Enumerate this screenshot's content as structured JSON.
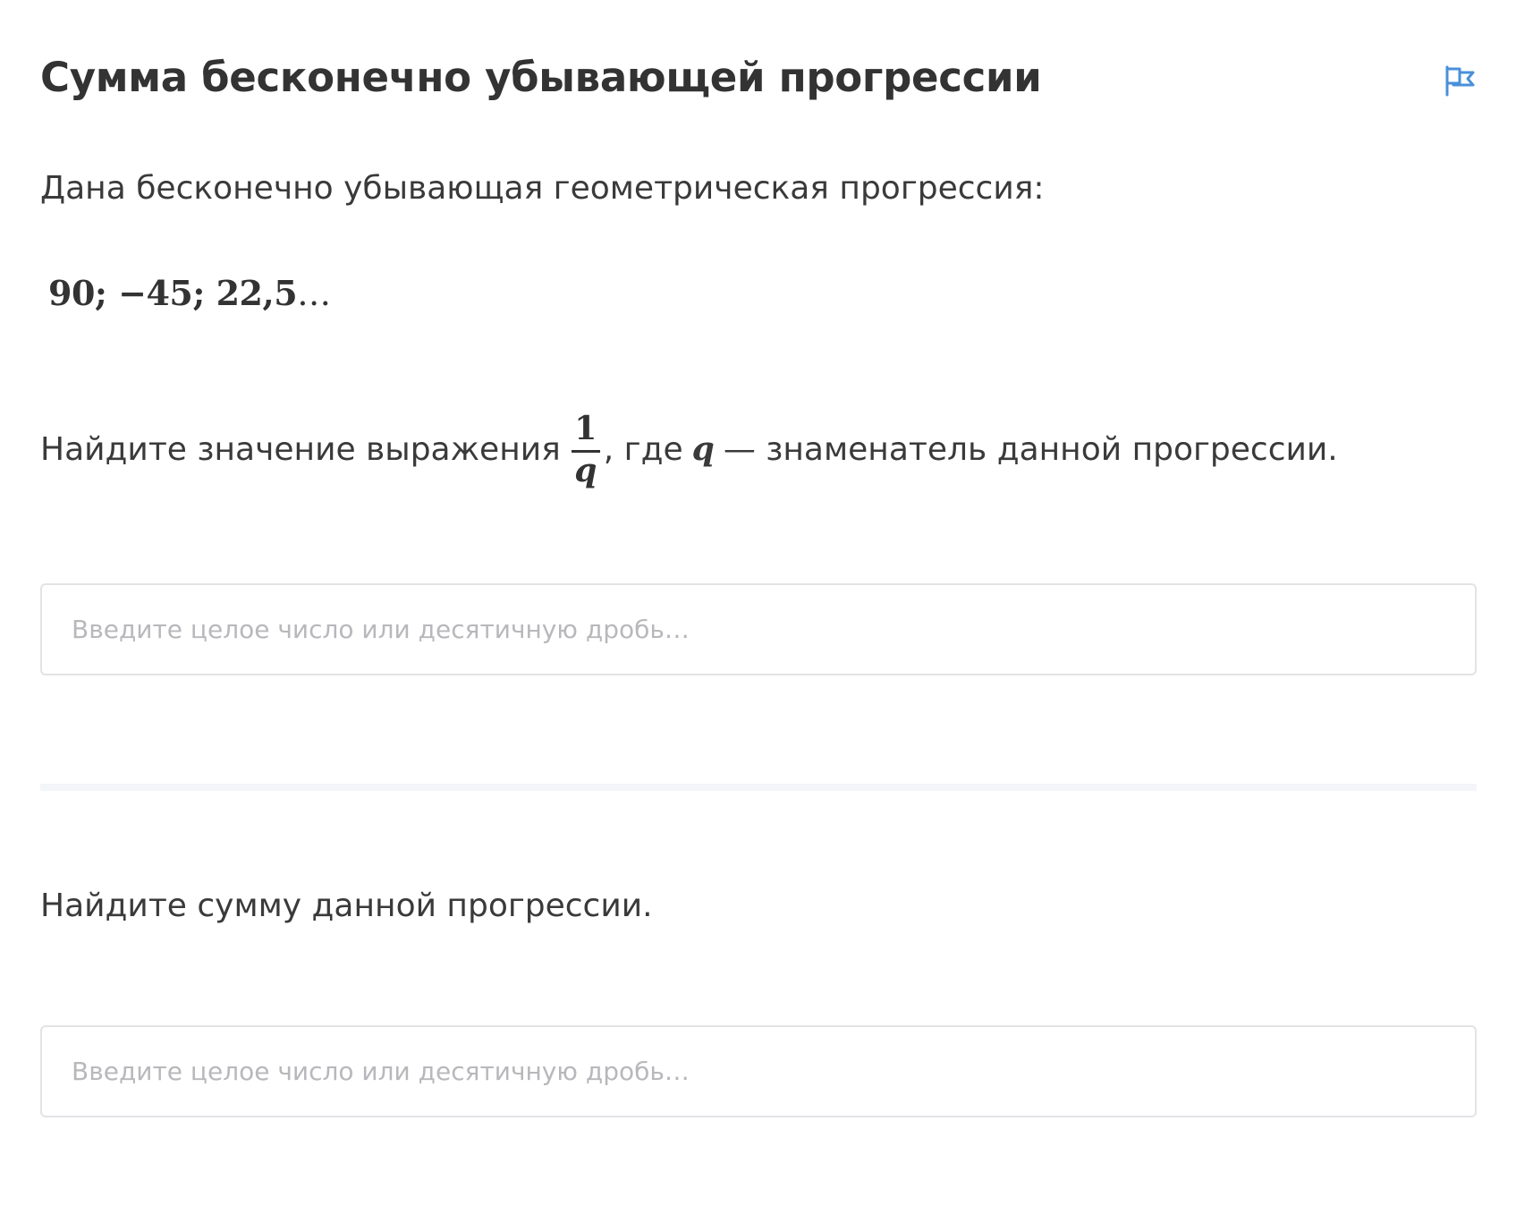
{
  "task": {
    "title": "Сумма бесконечно убывающей прогрессии",
    "intro": "Дана бесконечно убывающая геометрическая прогрессия:",
    "sequence": "90; −45; 22,5",
    "sequence_ellipsis": "…"
  },
  "question1": {
    "prefix": "Найдите значение выражения",
    "fraction_numerator": "1",
    "fraction_denominator": "q",
    "middle": ", где",
    "variable": "q",
    "suffix": "— знаменатель данной прогрессии.",
    "input": {
      "placeholder": "Введите целое число или десятичную дробь…",
      "value": ""
    }
  },
  "question2": {
    "text": "Найдите сумму данной прогрессии.",
    "input": {
      "placeholder": "Введите целое число или десятичную дробь…",
      "value": ""
    }
  },
  "icons": {
    "report": "flag-icon"
  },
  "colors": {
    "accent": "#4a90d9",
    "text": "#333333",
    "input_border": "#e3e3e6",
    "placeholder": "#b8b8bc",
    "divider": "#f4f5f9"
  }
}
